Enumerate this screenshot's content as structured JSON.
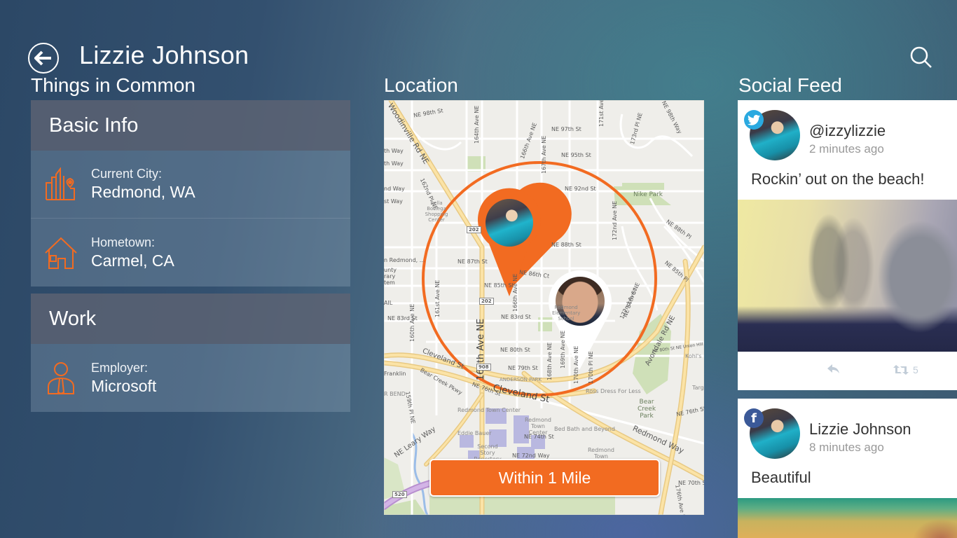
{
  "header": {
    "title": "Lizzie Johnson",
    "back_icon": "back-arrow-icon",
    "search_icon": "search-icon"
  },
  "sections": {
    "common": "Things in Common",
    "location": "Location",
    "social": "Social Feed"
  },
  "common": {
    "groups": [
      {
        "title": "Basic Info",
        "items": [
          {
            "icon": "city-pin-icon",
            "label": "Current City:",
            "value": "Redmond, WA"
          },
          {
            "icon": "house-icon",
            "label": "Hometown:",
            "value": "Carmel, CA"
          }
        ]
      },
      {
        "title": "Work",
        "items": [
          {
            "icon": "person-tie-icon",
            "label": "Employer:",
            "value": "Microsoft"
          }
        ]
      }
    ]
  },
  "map": {
    "radius_button": "Within 1 Mile",
    "accent": "#f26b21",
    "labels": {
      "woodinville": "Woodinville Rd NE",
      "ne98": "NE 98th St",
      "ne97": "NE 97th St",
      "ne95": "NE 95th St",
      "ne92": "NE 92nd St",
      "ne88": "NE 88th St",
      "ne88pl": "NE 88th Pl",
      "ne87": "NE 87th St",
      "ne86ct": "NE 86th Ct",
      "ne85": "NE 85th St",
      "ne85pl": "NE 85th Pl",
      "ne84": "NE 84th St",
      "ne83": "NE 83rd St",
      "ne83w": "NE 83rd St",
      "ne80": "NE 80th St",
      "ne79": "NE 79th St",
      "ne76": "NE 76th St",
      "ne76e": "NE 76th St",
      "ne74": "NE 74th St",
      "ne72": "NE 72nd Way",
      "ne70": "NE 70th St",
      "ne98way": "NE 98th Way",
      "ave164": "164th Ave NE",
      "ave164big": "164th Ave NE",
      "ave166": "166th Ave NE",
      "ave166s": "166th Ave NE",
      "ave167": "167th Ave NE",
      "ave171": "171st Ave NE",
      "ave172": "172nd Ave NE",
      "ave172s": "172nd Ave NE",
      "pl173": "173rd Pl NE",
      "pl162": "162nd Pl NE",
      "ave161": "161st Ave NE",
      "ave160": "160th Ave NE",
      "pl159": "159th Pl NE",
      "ave168": "168th Ave NE",
      "ave169": "169th Ave NE",
      "ave170": "170th Ave NE",
      "pl170": "170th Pl NE",
      "ave176": "176th Ave NE",
      "cleveland_w": "Cleveland St",
      "cleveland": "Cleveland St",
      "bearcreek": "Bear Creek Pkwy",
      "leary": "NE Leary Way",
      "redmondway": "Redmond Way",
      "avondale": "Avondale Rd NE",
      "ne80union": "NE 80th St  NE Union Hill",
      "nike": "Nike Park",
      "bearcreekpark": "Bear Creek Park",
      "anderson": "ANDERSON PARK",
      "rtc": "Redmond Town Center",
      "rtc2": "Redmond Town Center",
      "eddie": "Eddie Bauer",
      "secondstory": "Second Story Repertory",
      "bedbath": "Bed Bath and Beyond",
      "redmondtown": "Redmond Town",
      "ross": "Ross Dress For Less",
      "kohls": "Kohl's",
      "targ": "Targ",
      "bella": "Bella Bottega Shopping Center",
      "school": "Redmond Elementary School",
      "redmond_lib": "n Redmond, ...",
      "county": "unty rary tem",
      "franklin": "Franklin",
      "rbend": "R BEND",
      "way1": "th Way",
      "way2": "th Way",
      "way3": "nd Way",
      "way4": "st Way",
      "rail": "AIL",
      "shield202a": "202",
      "shield202b": "202",
      "shield908": "908",
      "shield520": "520"
    }
  },
  "feed": {
    "posts": [
      {
        "network": "twitter",
        "network_icon": "twitter-icon",
        "network_color": "#2aa9e0",
        "name": "@izzylizzie",
        "time": "2 minutes ago",
        "text": "Rockin’ out on the beach!",
        "retweets": "5"
      },
      {
        "network": "facebook",
        "network_icon": "facebook-icon",
        "network_color": "#3b5998",
        "name": "Lizzie Johnson",
        "time": "8 minutes ago",
        "text": "Beautiful"
      }
    ]
  }
}
